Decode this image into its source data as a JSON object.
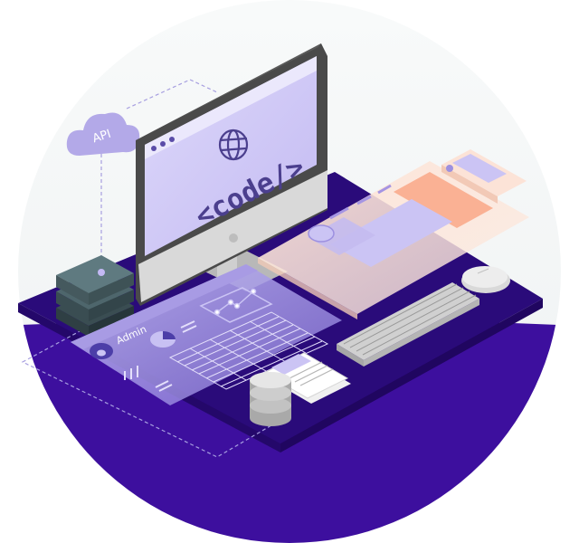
{
  "illustration": {
    "cloud_label": "API",
    "monitor_text": "<code/>",
    "admin_panel_label": "Admin",
    "icons": [
      "globe-icon",
      "cloud-icon",
      "pie-chart-icon",
      "line-chart-icon",
      "avatar-icon",
      "database-icon",
      "document-icon",
      "server-icon",
      "keyboard-icon",
      "mouse-icon"
    ],
    "colors": {
      "background_circle_top": "#f6f8f8",
      "background_circle_bottom": "#3d0f9e",
      "platform": "#2a0b7a",
      "accent_lavender": "#cbc4f4",
      "accent_peach": "#fcd7c6",
      "monitor_frame": "#4a4a4a"
    }
  }
}
